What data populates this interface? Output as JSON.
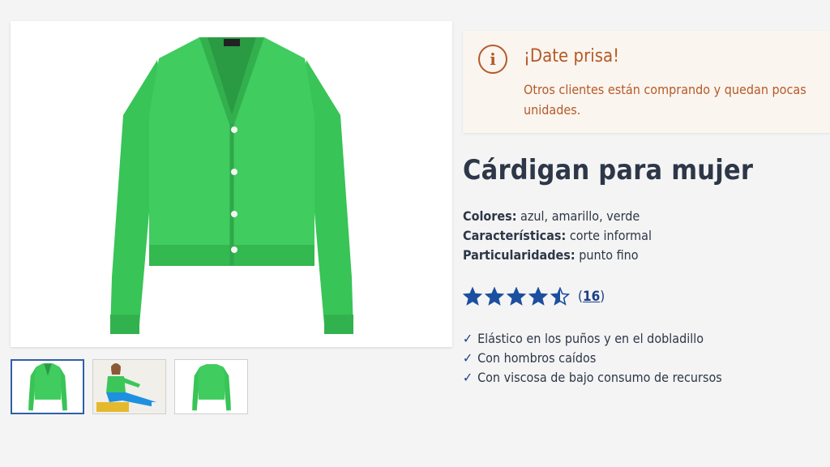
{
  "alert": {
    "icon": "info-icon",
    "title": "¡Date prisa!",
    "text": "Otros clientes están comprando y quedan pocas unidades.",
    "color": "#b45a28"
  },
  "product": {
    "title": "Cárdigan para mujer",
    "specs": [
      {
        "label": "Colores:",
        "value": "azul, amarillo, verde"
      },
      {
        "label": "Características:",
        "value": "corte informal"
      },
      {
        "label": "Particularidades:",
        "value": "punto fino"
      }
    ],
    "rating": {
      "stars": 4.5,
      "max": 5,
      "count": "16",
      "star_color": "#1b4fa0"
    },
    "features": [
      "Elástico en los puños y en el dobladillo",
      "Con hombros caídos",
      "Con viscosa de bajo consumo de recursos"
    ]
  },
  "gallery": {
    "main": "green-cardigan-front",
    "thumbnails": [
      "green-cardigan-front",
      "model-wearing-cardigan",
      "green-cardigan-back"
    ],
    "selected_index": 0,
    "garment_color": "#3cc65a"
  }
}
